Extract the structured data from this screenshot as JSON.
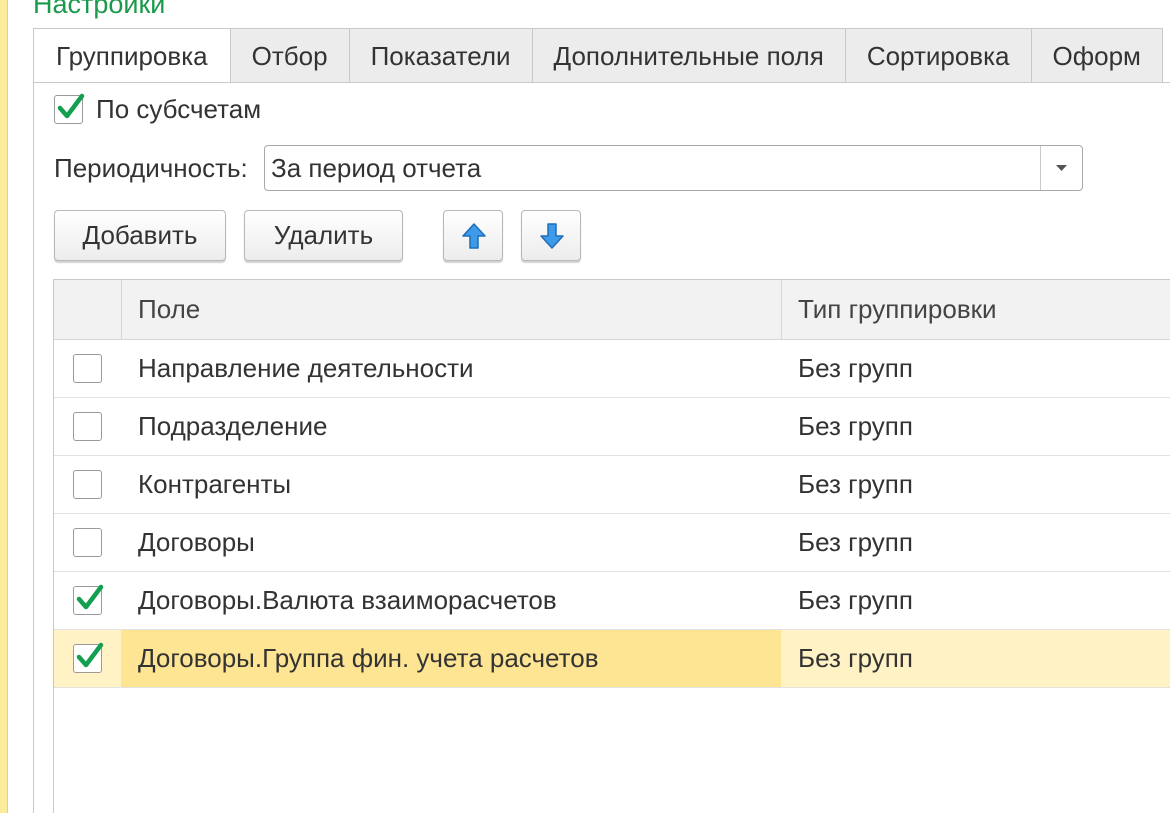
{
  "title": "Настройки",
  "tabs": [
    {
      "label": "Группировка",
      "active": true
    },
    {
      "label": "Отбор",
      "active": false
    },
    {
      "label": "Показатели",
      "active": false
    },
    {
      "label": "Дополнительные поля",
      "active": false
    },
    {
      "label": "Сортировка",
      "active": false
    },
    {
      "label": "Оформ",
      "active": false
    }
  ],
  "by_subaccounts": {
    "label": "По субсчетам",
    "checked": true
  },
  "periodicity": {
    "label": "Периодичность:",
    "value": "За период отчета"
  },
  "toolbar": {
    "add_label": "Добавить",
    "delete_label": "Удалить",
    "move_up_icon": "arrow-up-icon",
    "move_down_icon": "arrow-down-icon"
  },
  "grid": {
    "columns": [
      "Поле",
      "Тип группировки"
    ],
    "rows": [
      {
        "field": "Направление деятельности",
        "type": "Без групп",
        "checked": false
      },
      {
        "field": "Подразделение",
        "type": "Без групп",
        "checked": false
      },
      {
        "field": "Контрагенты",
        "type": "Без групп",
        "checked": false
      },
      {
        "field": "Договоры",
        "type": "Без групп",
        "checked": false
      },
      {
        "field": "Договоры.Валюта взаиморасчетов",
        "type": "Без групп",
        "checked": true
      },
      {
        "field": "Договоры.Группа фин. учета расчетов",
        "type": "Без групп",
        "checked": true,
        "selected": true
      }
    ]
  },
  "colors": {
    "accent_green": "#1a9a4a",
    "check_green": "#12a050",
    "selection": "#fde594",
    "selection_row": "#fff3c6",
    "arrow_blue": "#3d9be9"
  }
}
